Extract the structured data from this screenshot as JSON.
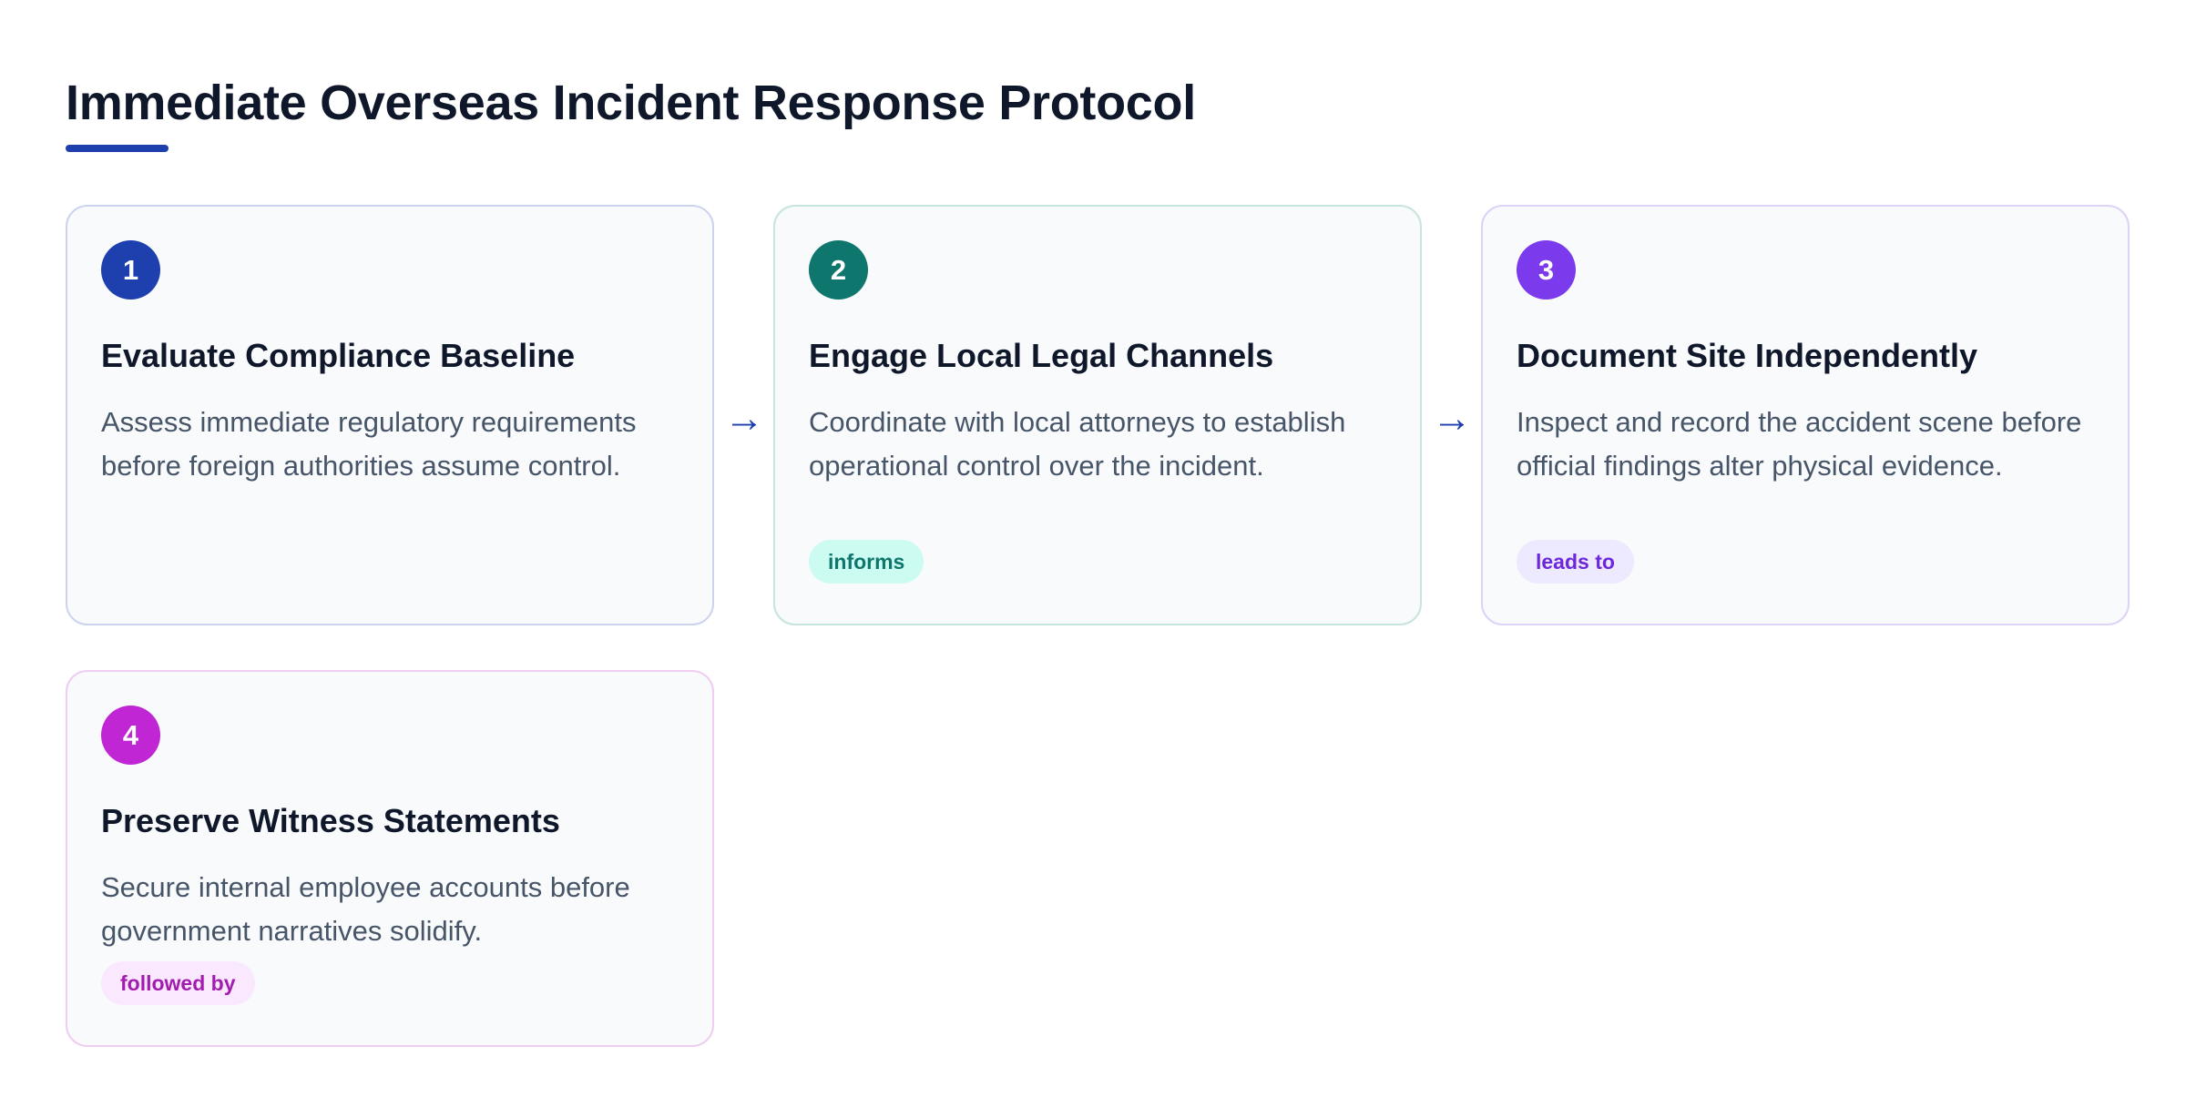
{
  "page": {
    "title": "Immediate Overseas Incident Response Protocol"
  },
  "steps": [
    {
      "number": "1",
      "title": "Evaluate Compliance Baseline",
      "description": "Assess immediate regulatory requirements before foreign authorities assume control.",
      "tag": "",
      "color": "#1e40af"
    },
    {
      "number": "2",
      "title": "Engage Local Legal Channels",
      "description": "Coordinate with local attorneys to establish operational control over the incident.",
      "tag": "informs",
      "color": "#0f766e"
    },
    {
      "number": "3",
      "title": "Document Site Independently",
      "description": "Inspect and record the accident scene before official findings alter physical evidence.",
      "tag": "leads to",
      "color": "#7c3aed"
    },
    {
      "number": "4",
      "title": "Preserve Witness Statements",
      "description": "Secure internal employee accounts before government narratives solidify.",
      "tag": "followed by",
      "color": "#c026d3"
    }
  ],
  "connectors": [
    {
      "glyph": "→",
      "from": "1",
      "to": "2"
    },
    {
      "glyph": "→",
      "from": "2",
      "to": "3"
    }
  ],
  "colors": {
    "accent": "#1e40af",
    "title_text": "#0f172a",
    "body_text": "#475569",
    "card_background": "#f8fafc"
  }
}
